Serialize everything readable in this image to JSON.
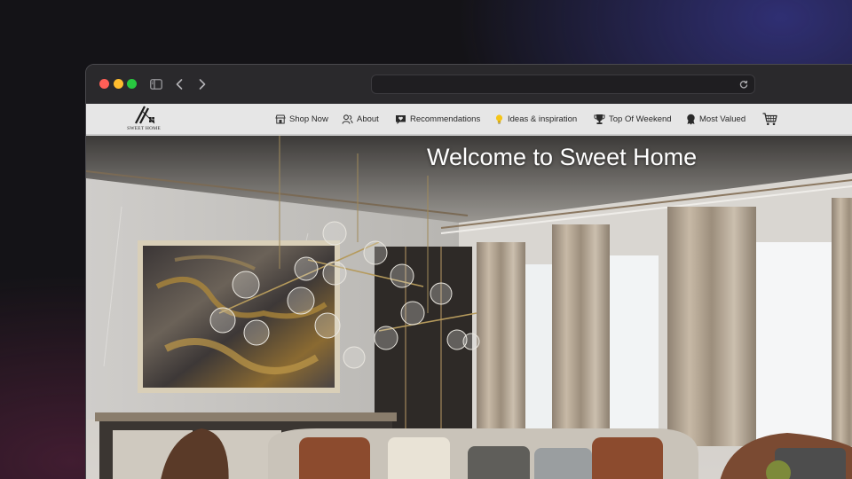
{
  "browser": {
    "url": "",
    "url_placeholder": ""
  },
  "site": {
    "logo_text": "SWEET HOME",
    "nav": [
      {
        "label": "Shop Now",
        "icon": "store-icon"
      },
      {
        "label": "About",
        "icon": "people-icon"
      },
      {
        "label": "Recommendations",
        "icon": "chat-heart-icon"
      },
      {
        "label": "Ideas & inspiration",
        "icon": "lightbulb-icon"
      },
      {
        "label": "Top Of Weekend",
        "icon": "trophy-icon"
      },
      {
        "label": "Most Valued",
        "icon": "medal-icon"
      }
    ],
    "cart_icon": "cart-icon",
    "hero_title": "Welcome to Sweet Home"
  },
  "colors": {
    "traffic_red": "#ff5f57",
    "traffic_yellow": "#febc2e",
    "traffic_green": "#28c840",
    "navbar_bg": "#e6e6e6",
    "hero_title": "#ffffff"
  }
}
